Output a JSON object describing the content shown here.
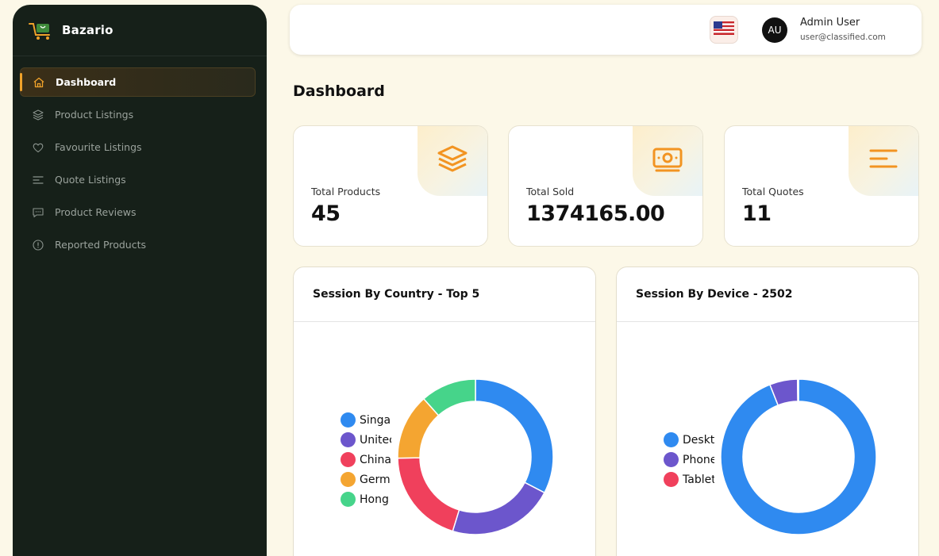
{
  "brand": {
    "name": "Bazario"
  },
  "sidebar": {
    "items": [
      {
        "label": "Dashboard",
        "icon": "home-icon",
        "active": true
      },
      {
        "label": "Product Listings",
        "icon": "layers-icon"
      },
      {
        "label": "Favourite Listings",
        "icon": "heart-icon"
      },
      {
        "label": "Quote Listings",
        "icon": "lines-icon"
      },
      {
        "label": "Product Reviews",
        "icon": "message-icon"
      },
      {
        "label": "Reported Products",
        "icon": "alert-circle-icon"
      }
    ]
  },
  "header": {
    "flag_icon": "us-flag-icon",
    "avatar_initials": "AU",
    "user_name": "Admin User",
    "user_email": "user@classified.com"
  },
  "page": {
    "title": "Dashboard"
  },
  "stats": [
    {
      "label": "Total Products",
      "value": "45",
      "icon": "layers-icon"
    },
    {
      "label": "Total Sold",
      "value": "1374165.00",
      "icon": "money-icon"
    },
    {
      "label": "Total Quotes",
      "value": "11",
      "icon": "lines-icon"
    }
  ],
  "charts": {
    "country": {
      "title": "Session By Country - Top 5"
    },
    "device": {
      "title": "Session By Device - 2502"
    }
  },
  "colors": {
    "accent": "#f0a22a",
    "sidebar_bg": "#162019",
    "page_bg": "#fcf8e8"
  },
  "chart_data": [
    {
      "type": "pie",
      "title": "Session By Country - Top 5",
      "categories": [
        "Singap",
        "Unitec",
        "China",
        "Germ",
        "Hong"
      ],
      "values": [
        31,
        21,
        19,
        13,
        11
      ],
      "colors": [
        "#2f8af0",
        "#6c56cc",
        "#f0405c",
        "#f4a531",
        "#46d48a"
      ],
      "donut": true
    },
    {
      "type": "pie",
      "title": "Session By Device - 2502",
      "categories": [
        "Deskt",
        "Phone",
        "Tablet"
      ],
      "values": [
        94,
        5.8,
        0.2
      ],
      "colors": [
        "#2f8af0",
        "#6c56cc",
        "#f0405c"
      ],
      "donut": true
    }
  ]
}
